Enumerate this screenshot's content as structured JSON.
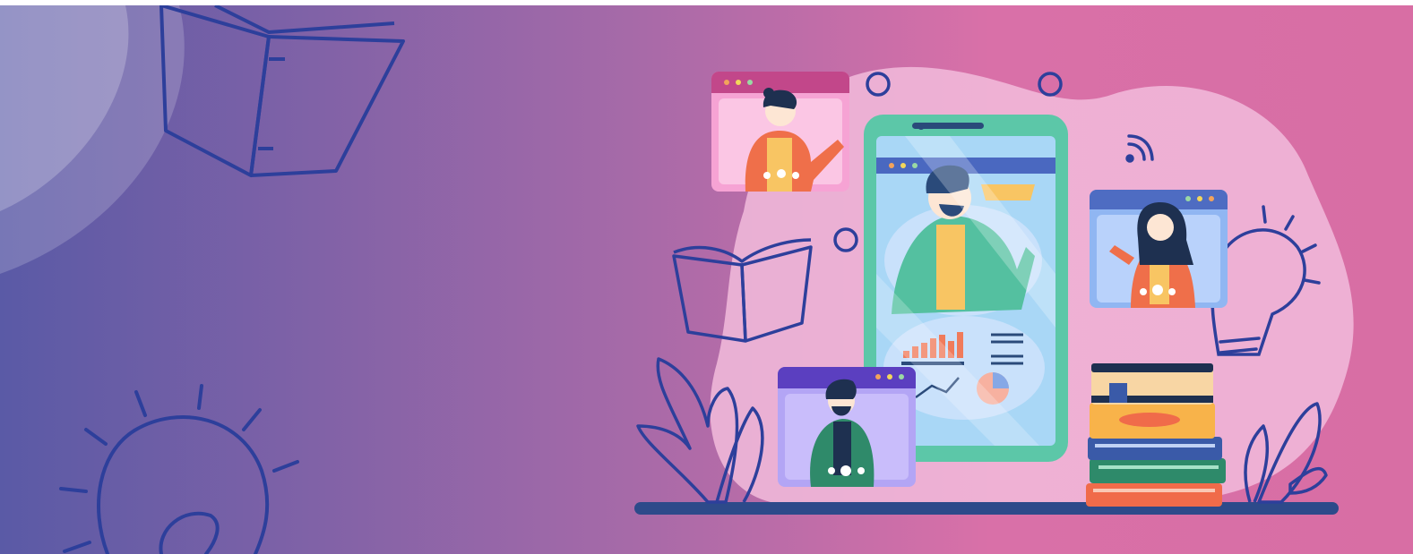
{
  "banner": {
    "gradient_start": "#5b5aa8",
    "gradient_end": "#d86fa8",
    "outline_color": "#2b3f9a",
    "blob_color": "#f0b8d8",
    "phone_color": "#5cc7a8",
    "icons": [
      "book-icon",
      "lightbulb-icon",
      "leaf-icon",
      "wifi-icon",
      "phone-icon",
      "book-stack-icon",
      "video-call-window-icon"
    ]
  }
}
